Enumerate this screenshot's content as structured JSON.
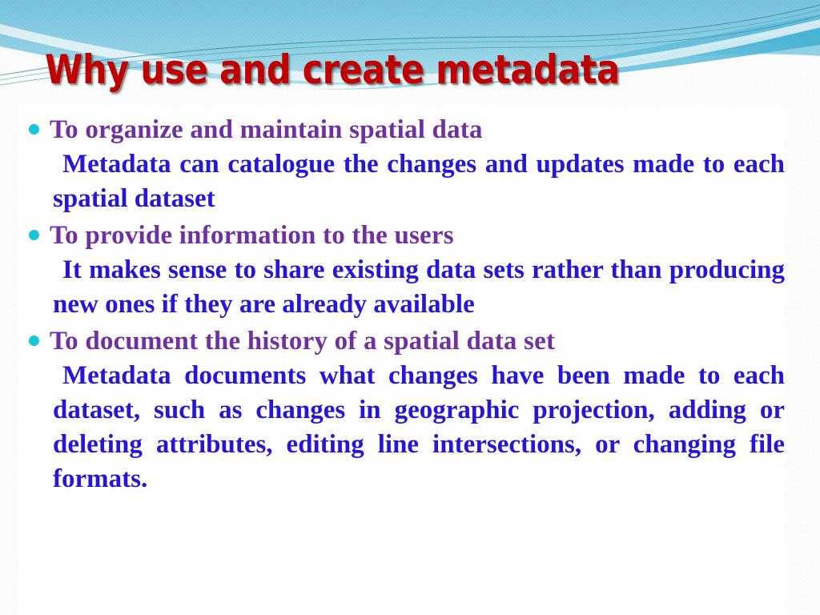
{
  "slide": {
    "title": "Why use and create metadata",
    "title_color": "#C00000",
    "heading_color": "#7030A0",
    "detail_color": "#2516D8",
    "bullet_color": "#17C7D8",
    "header_band_color": "#7FC9E3",
    "background_color": "#FFFFFF"
  },
  "sections": [
    {
      "heading": "To organize and maintain spatial data",
      "detail": "Metadata can catalogue the changes and updates made to each spatial dataset"
    },
    {
      "heading": "To provide information to the users",
      "detail": "It makes sense to share existing data sets rather than producing new ones if they are already available"
    },
    {
      "heading": "To document the history of a spatial data set",
      "detail": "Metadata documents what changes have been made to each dataset, such as changes in geographic projection, adding or deleting attributes, editing line intersections, or changing file formats."
    }
  ]
}
